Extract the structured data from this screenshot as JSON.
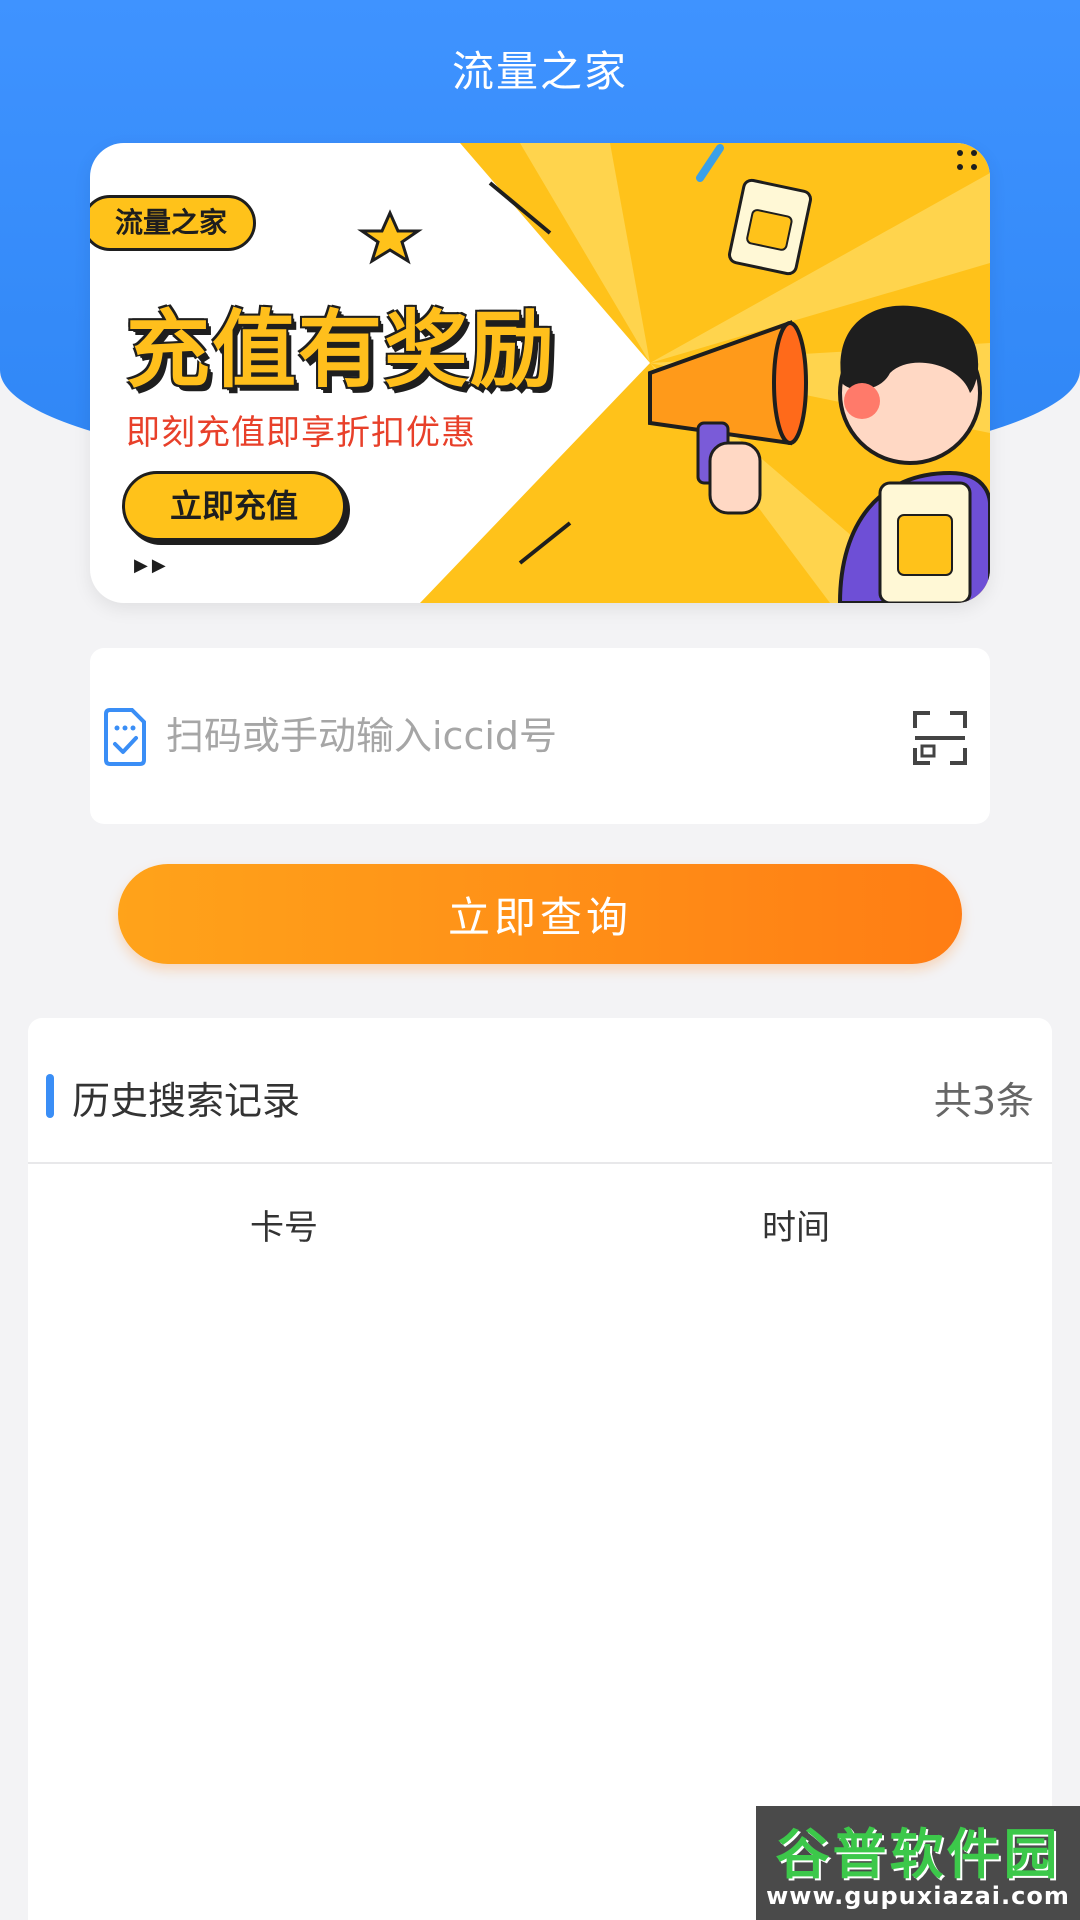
{
  "header": {
    "title": "流量之家"
  },
  "banner": {
    "tag": "流量之家",
    "headline": "充值有奖励",
    "subline": "即刻充值即享折扣优惠",
    "cta": "立即充值",
    "arrows": "▶▶"
  },
  "search": {
    "placeholder": "扫码或手动输入iccid号",
    "value": "",
    "left_icon": "sim-card-icon",
    "right_icon": "scan-icon"
  },
  "actions": {
    "query_label": "立即查询"
  },
  "history": {
    "title": "历史搜索记录",
    "count": "共3条",
    "columns": [
      "卡号",
      "时间"
    ],
    "rows": []
  },
  "watermark": {
    "title": "谷普软件园",
    "url": "www.gupuxiazai.com"
  },
  "colors": {
    "header_blue": "#3f93ff",
    "button_orange_start": "#ffa31a",
    "button_orange_end": "#ff7d14",
    "accent_blue": "#3a8ef6",
    "banner_yellow": "#ffc21a",
    "banner_red_text": "#e8402a"
  }
}
